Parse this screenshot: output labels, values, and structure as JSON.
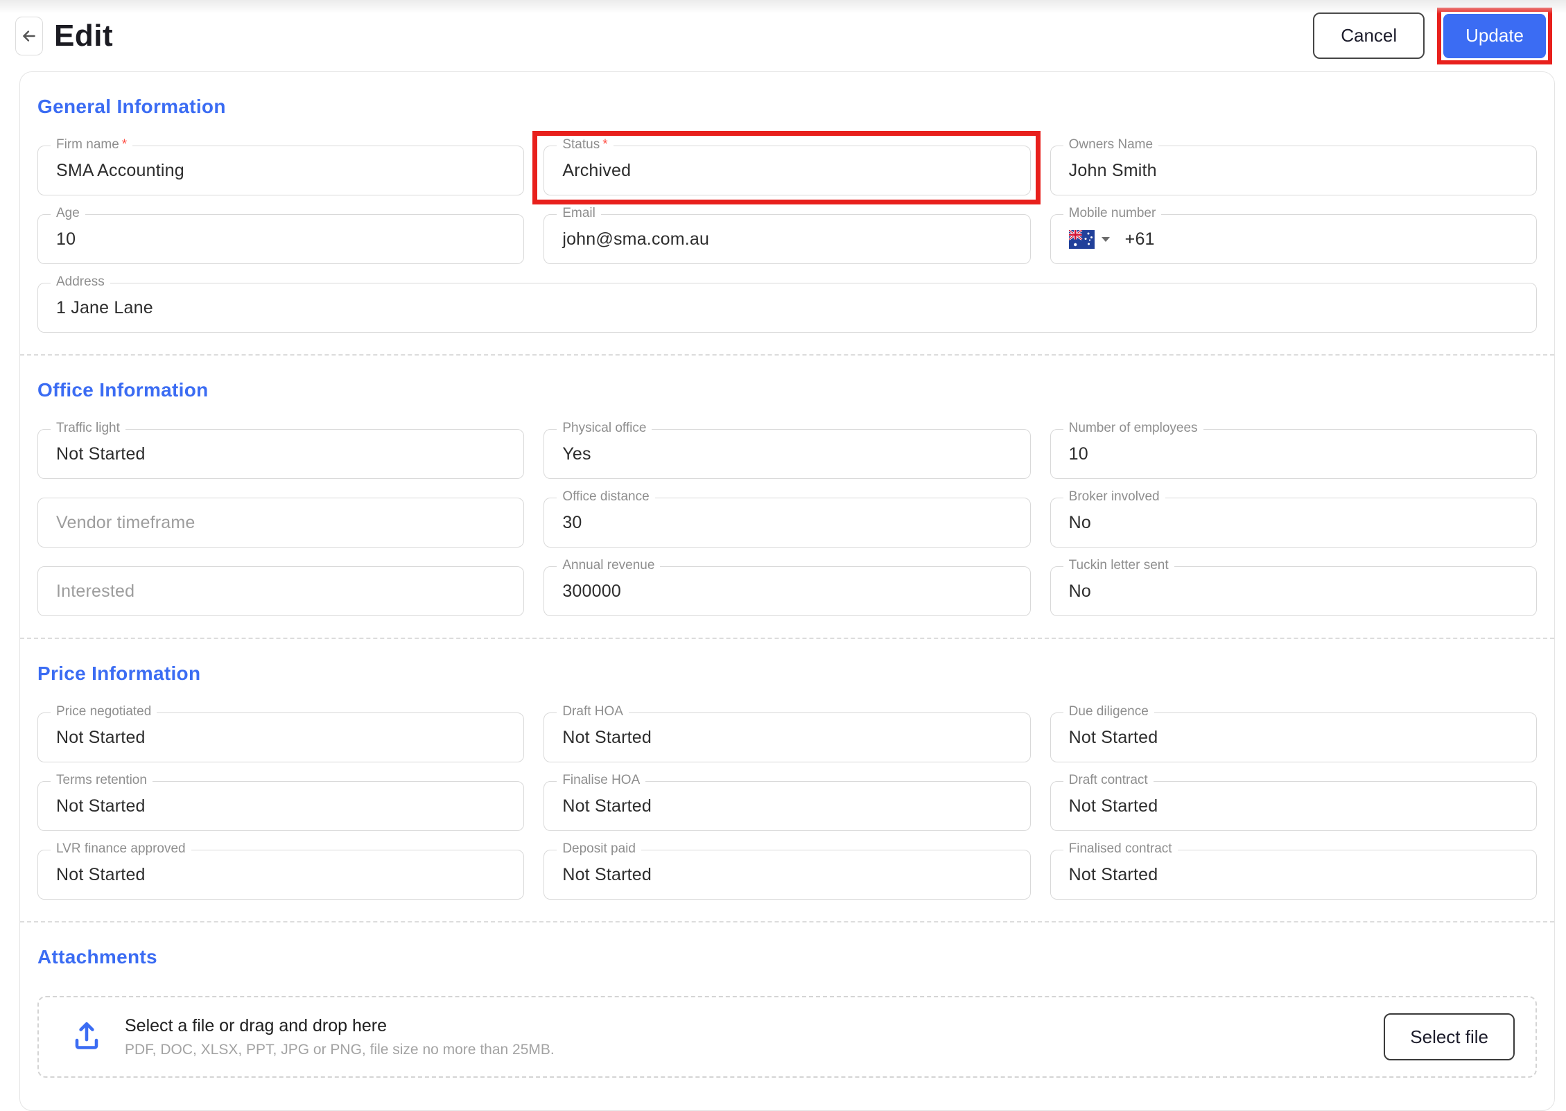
{
  "page": {
    "title": "Edit",
    "back_icon": "arrow-left-icon"
  },
  "toolbar": {
    "cancel_label": "Cancel",
    "update_label": "Update"
  },
  "colors": {
    "accent": "#3b6cf3",
    "annotation": "#e8201c"
  },
  "annotations": {
    "highlighted_field": "Status",
    "highlighted_button": "Update"
  },
  "sections": {
    "general": {
      "title": "General Information",
      "fields": {
        "firm_name": {
          "label": "Firm name",
          "required": "*",
          "value": "SMA Accounting"
        },
        "status": {
          "label": "Status",
          "required": "*",
          "value": "Archived"
        },
        "owners_name": {
          "label": "Owners Name",
          "value": "John Smith"
        },
        "age": {
          "label": "Age",
          "value": "10"
        },
        "email": {
          "label": "Email",
          "value": "john@sma.com.au"
        },
        "mobile": {
          "label": "Mobile number",
          "dial_code": "+61",
          "flag_icon": "australia-flag-icon",
          "caret_icon": "dropdown-caret-icon"
        },
        "address": {
          "label": "Address",
          "value": "1 Jane Lane"
        }
      }
    },
    "office": {
      "title": "Office Information",
      "fields": {
        "traffic_light": {
          "label": "Traffic light",
          "value": "Not Started"
        },
        "physical_office": {
          "label": "Physical office",
          "value": "Yes"
        },
        "employees": {
          "label": "Number of employees",
          "value": "10"
        },
        "vendor_timeframe": {
          "placeholder": "Vendor timeframe"
        },
        "office_distance": {
          "label": "Office distance",
          "value": "30"
        },
        "broker_involved": {
          "label": "Broker involved",
          "value": "No"
        },
        "interested": {
          "placeholder": "Interested"
        },
        "annual_revenue": {
          "label": "Annual revenue",
          "value": "300000"
        },
        "tuckin_letter": {
          "label": "Tuckin letter sent",
          "value": "No"
        }
      }
    },
    "price": {
      "title": "Price Information",
      "fields": {
        "price_negotiated": {
          "label": "Price negotiated",
          "value": "Not Started"
        },
        "draft_hoa": {
          "label": "Draft HOA",
          "value": "Not Started"
        },
        "due_diligence": {
          "label": "Due diligence",
          "value": "Not Started"
        },
        "terms_retention": {
          "label": "Terms retention",
          "value": "Not Started"
        },
        "finalise_hoa": {
          "label": "Finalise HOA",
          "value": "Not Started"
        },
        "draft_contract": {
          "label": "Draft contract",
          "value": "Not Started"
        },
        "lvr_finance": {
          "label": "LVR finance approved",
          "value": "Not Started"
        },
        "deposit_paid": {
          "label": "Deposit paid",
          "value": "Not Started"
        },
        "finalised_contract": {
          "label": "Finalised contract",
          "value": "Not Started"
        }
      }
    },
    "attachments": {
      "title": "Attachments",
      "upload_icon": "upload-icon",
      "dropzone_title": "Select a file or drag and drop here",
      "dropzone_hint": "PDF, DOC, XLSX, PPT, JPG or PNG, file size no more than 25MB.",
      "select_file_label": "Select file"
    }
  }
}
